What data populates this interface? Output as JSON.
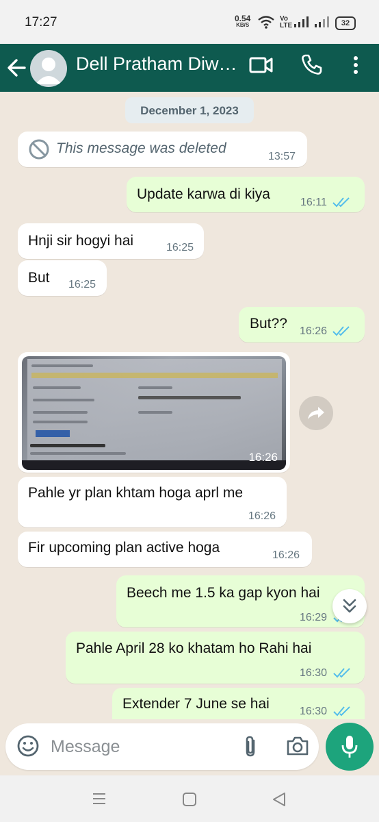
{
  "status_bar": {
    "time": "17:27",
    "net_speed_value": "0.54",
    "net_speed_unit": "KB/S",
    "volte": "Vo LTE",
    "battery": "32"
  },
  "header": {
    "contact_name": "Dell Pratham Diw…",
    "icons": [
      "back-arrow-icon",
      "avatar",
      "video-call-icon",
      "voice-call-icon",
      "more-menu-icon"
    ]
  },
  "chat": {
    "date_chip": "December 1, 2023",
    "messages": [
      {
        "direction": "in",
        "text": "This message was deleted",
        "time": "13:57",
        "deleted": true
      },
      {
        "direction": "out",
        "text": "Update karwa di kiya",
        "time": "16:11",
        "status": "read"
      },
      {
        "direction": "in",
        "text": "Hnji sir hogyi hai",
        "time": "16:25"
      },
      {
        "direction": "in",
        "text": "But",
        "time": "16:25"
      },
      {
        "direction": "out",
        "text": "But??",
        "time": "16:26",
        "status": "read"
      },
      {
        "direction": "in",
        "type": "image",
        "time": "16:26"
      },
      {
        "direction": "in",
        "text": "Pahle yr plan khtam hoga aprl me",
        "time": "16:26"
      },
      {
        "direction": "in",
        "text": "Fir upcoming  plan active hoga",
        "time": "16:26"
      },
      {
        "direction": "out",
        "text": "Beech me 1.5 ka gap kyon hai",
        "time": "16:29",
        "status": "read"
      },
      {
        "direction": "out",
        "text": "Pahle April 28 ko khatam ho Rahi hai",
        "time": "16:30",
        "status": "read"
      },
      {
        "direction": "out",
        "text": "Extender 7 June se hai",
        "time": "16:30",
        "status": "read"
      }
    ]
  },
  "composer": {
    "placeholder": "Message"
  },
  "colors": {
    "header_bg": "#0e5a4f",
    "outgoing_bubble": "#e7fed6",
    "incoming_bubble": "#ffffff",
    "chat_bg": "#efe7dd",
    "mic_button": "#1da47c",
    "read_ticks": "#53bdeb"
  }
}
